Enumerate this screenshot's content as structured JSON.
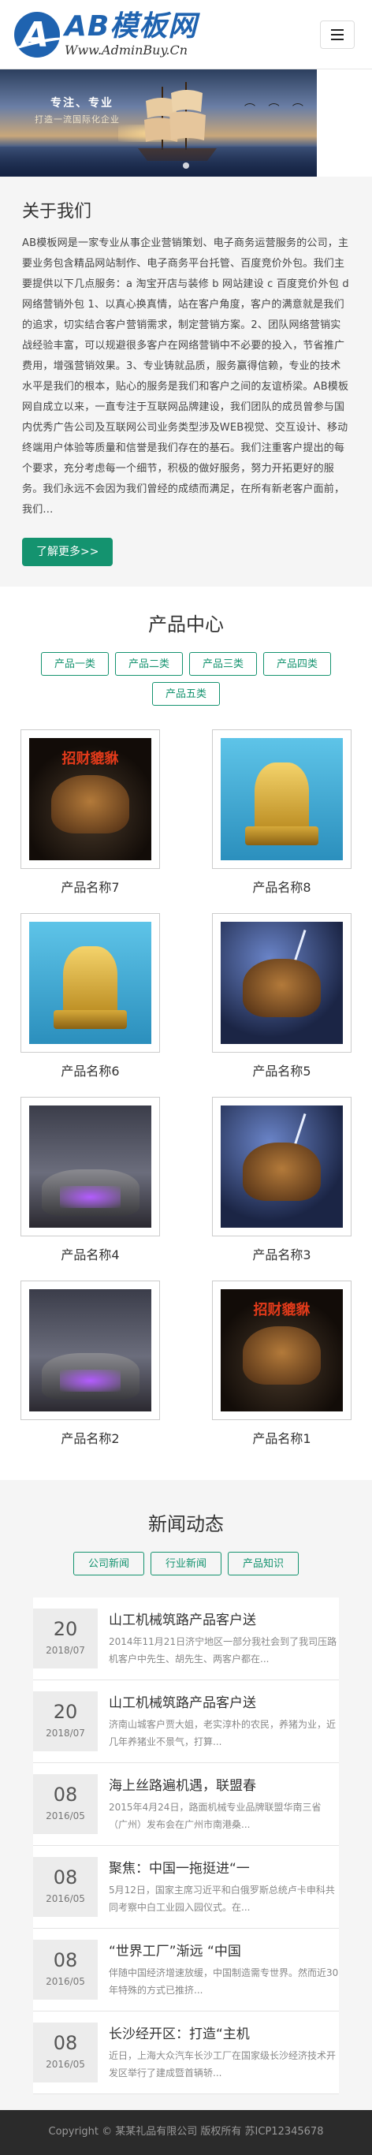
{
  "header": {
    "logo_main": "AB模板网",
    "logo_sub": "Www.AdminBuy.Cn"
  },
  "banner": {
    "line1": "专注、专业",
    "line2": "打造一流国际化企业"
  },
  "about": {
    "title": "关于我们",
    "text": "AB模板网是一家专业从事企业营销策划、电子商务运营服务的公司，主要业务包含精品网站制作、电子商务平台托管、百度竞价外包。我们主要提供以下几点服务：a 淘宝开店与装修 b 网站建设 c 百度竞价外包 d 网络营销外包 1、以真心换真情，站在客户角度，客户的满意就是我们的追求，切实结合客户营销需求，制定营销方案。2、团队网络营销实战经验丰富，可以规避很多客户在网络营销中不必要的投入，节省推广费用，增强营销效果。3、专业铸就品质，服务赢得信赖，专业的技术水平是我们的根本，贴心的服务是我们和客户之间的友谊桥梁。AB模板网自成立以来，一直专注于互联网品牌建设，我们团队的成员曾参与国内优秀广告公司及互联网公司业务类型涉及WEB视觉、交互设计、移动终端用户体验等质量和信誉是我们存在的基石。我们注重客户提出的每个要求，充分考虑每一个细节，积极的做好服务，努力开拓更好的服务。我们永远不会因为我们曾经的成绩而满足，在所有新老客户面前，我们...",
    "more_label": "了解更多>>"
  },
  "products": {
    "title": "产品中心",
    "categories": [
      "产品一类",
      "产品二类",
      "产品三类",
      "产品四类",
      "产品五类"
    ],
    "items": [
      {
        "name": "产品名称7",
        "style": "dark"
      },
      {
        "name": "产品名称8",
        "style": "teal"
      },
      {
        "name": "产品名称6",
        "style": "teal"
      },
      {
        "name": "产品名称5",
        "style": "storm"
      },
      {
        "name": "产品名称4",
        "style": "mist"
      },
      {
        "name": "产品名称3",
        "style": "storm"
      },
      {
        "name": "产品名称2",
        "style": "mist"
      },
      {
        "name": "产品名称1",
        "style": "dark"
      }
    ],
    "image_text": "招财貔貅"
  },
  "news": {
    "title": "新闻动态",
    "categories": [
      "公司新闻",
      "行业新闻",
      "产品知识"
    ],
    "items": [
      {
        "day": "20",
        "ym": "2018/07",
        "title": "山工机械筑路产品客户送",
        "desc": "2014年11月21日济宁地区一部分我社会到了我司压路机客户中先生、胡先生、两客户都在..."
      },
      {
        "day": "20",
        "ym": "2018/07",
        "title": "山工机械筑路产品客户送",
        "desc": "济南山城客户贾大姐，老实淳朴的农民，养猪为业，近几年养猪业不景气，打算..."
      },
      {
        "day": "08",
        "ym": "2016/05",
        "title": "海上丝路遍机遇，联盟春",
        "desc": "2015年4月24日，路面机械专业品牌联盟华南三省（广州）发布会在广州市南港桑..."
      },
      {
        "day": "08",
        "ym": "2016/05",
        "title": "聚焦：中国一拖挺进“一",
        "desc": "5月12日，国家主席习近平和白俄罗斯总统卢卡申科共同考察中白工业园入园仪式。在..."
      },
      {
        "day": "08",
        "ym": "2016/05",
        "title": "“世界工厂”渐远 “中国",
        "desc": "伴随中国经济增速放缓，中国制造需专世界。然而近30年特殊的方式已推挤..."
      },
      {
        "day": "08",
        "ym": "2016/05",
        "title": "长沙经开区：打造“主机",
        "desc": "近日，上海大众汽车长沙工厂在国家级长沙经济技术开发区举行了建成暨首辆轿..."
      }
    ]
  },
  "footer": {
    "text": "Copyright © 某某礼品有限公司 版权所有 苏ICP12345678"
  }
}
